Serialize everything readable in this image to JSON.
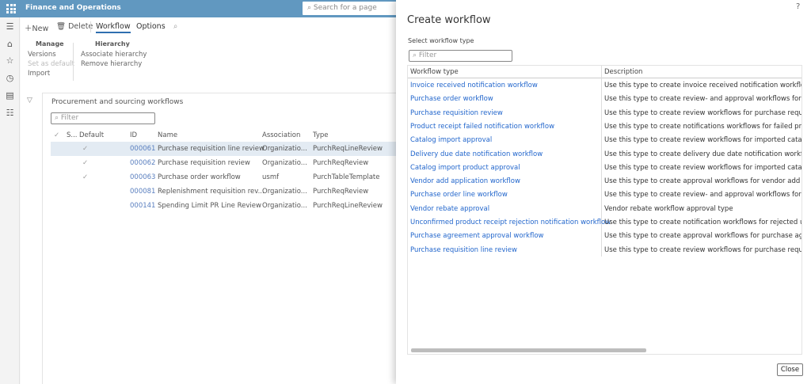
{
  "app": {
    "title": "Finance and Operations",
    "search_placeholder": "Search for a page"
  },
  "toolbar": {
    "new": "New",
    "delete": "Delete",
    "tab_workflow": "Workflow",
    "tab_options": "Options"
  },
  "ribbon": {
    "manage": {
      "title": "Manage",
      "items": [
        "Versions",
        "Set as default",
        "Import"
      ]
    },
    "hierarchy": {
      "title": "Hierarchy",
      "items": [
        "Associate hierarchy",
        "Remove hierarchy"
      ]
    }
  },
  "list": {
    "title": "Procurement and sourcing workflows",
    "filter_placeholder": "Filter",
    "columns": [
      "S...",
      "Default",
      "ID",
      "Name",
      "Association",
      "Type"
    ],
    "rows": [
      {
        "default": true,
        "id": "000061",
        "name": "Purchase requisition line review",
        "association": "Organizatio...",
        "type": "PurchReqLineReview",
        "selected": true
      },
      {
        "default": true,
        "id": "000062",
        "name": "Purchase requisition review",
        "association": "Organizatio...",
        "type": "PurchReqReview"
      },
      {
        "default": true,
        "id": "000063",
        "name": "Purchase order workflow",
        "association": "usmf",
        "type": "PurchTableTemplate"
      },
      {
        "default": false,
        "id": "000081",
        "name": "Replenishment requisition rev...",
        "association": "Organizatio...",
        "type": "PurchReqReview"
      },
      {
        "default": false,
        "id": "000141",
        "name": "Spending Limit PR Line Review",
        "association": "Organizatio...",
        "type": "PurchReqLineReview"
      }
    ]
  },
  "dialog": {
    "help": "?",
    "title": "Create workflow",
    "select_label": "Select workflow type",
    "filter_placeholder": "Filter",
    "columns": [
      "Workflow type",
      "Description"
    ],
    "rows": [
      {
        "type": "Invoice received notification workflow",
        "description": "Use this type to create invoice received notification workflow"
      },
      {
        "type": "Purchase order workflow",
        "description": "Use this type to create review- and approval workflows for p"
      },
      {
        "type": "Purchase requisition review",
        "description": "Use this type to create review workflows for purchase requis"
      },
      {
        "type": "Product receipt failed notification workflow",
        "description": "Use this type to create notifications workflows for failed pro"
      },
      {
        "type": "Catalog import approval",
        "description": "Use this type to create review workflows for imported catalo"
      },
      {
        "type": "Delivery due date notification workflow",
        "description": "Use this type to create delivery due date notification workflo"
      },
      {
        "type": "Catalog import product approval",
        "description": "Use this type to create review workflows for imported catalo"
      },
      {
        "type": "Vendor add application workflow",
        "description": "Use this type to create approval workflows for vendor add a"
      },
      {
        "type": "Purchase order line workflow",
        "description": "Use this type to create review- and approval workflows for p"
      },
      {
        "type": "Vendor rebate approval",
        "description": "Vendor rebate workflow approval type"
      },
      {
        "type": "Unconfirmed product receipt rejection notification workflow",
        "description": "Use this type to create notification workflows for rejected u"
      },
      {
        "type": "Purchase agreement approval workflow",
        "description": "Use this type to create approval workflows for purchase agr"
      },
      {
        "type": "Purchase requisition line review",
        "description": "Use this type to create review workflows for purchase requis"
      }
    ],
    "close": "Close"
  },
  "colors": {
    "header": "#6198c0",
    "link": "#2266cc"
  }
}
